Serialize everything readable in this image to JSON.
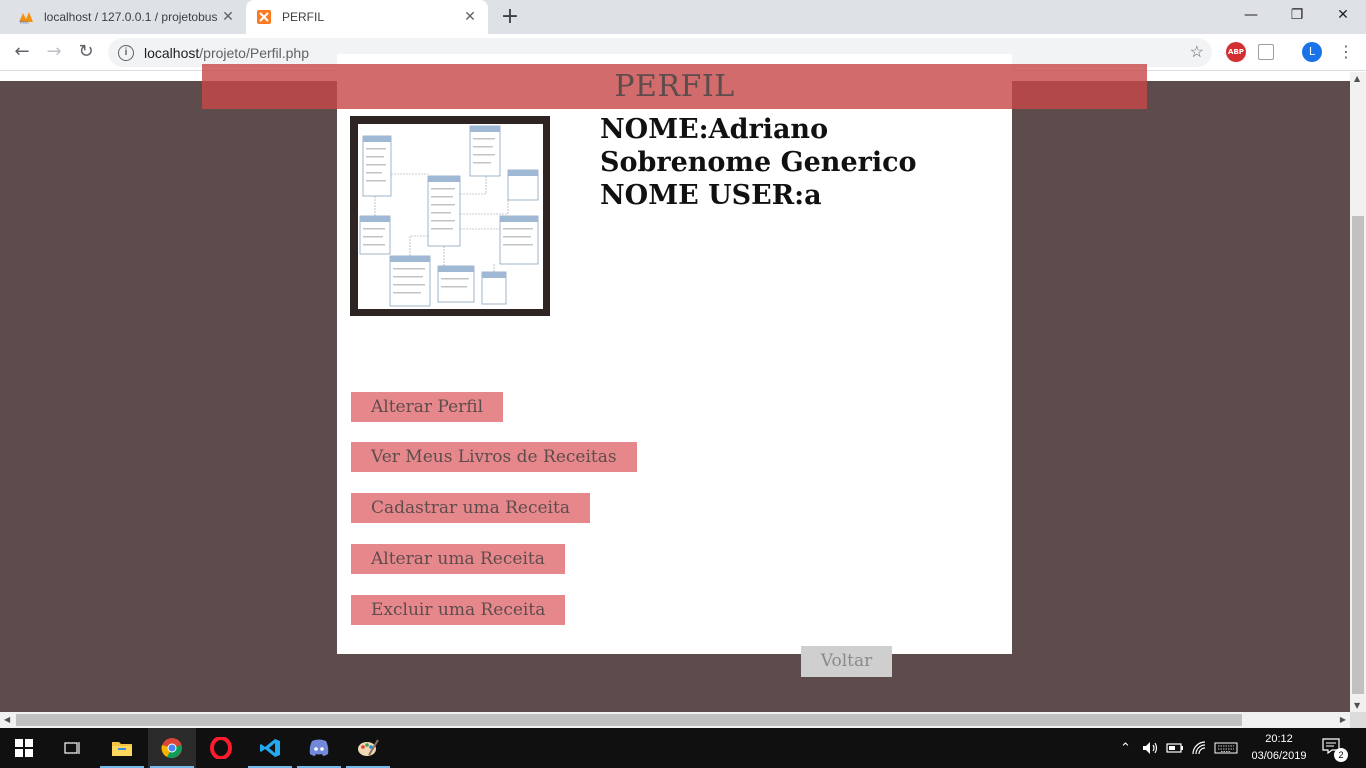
{
  "browser": {
    "tabs": [
      {
        "title": "localhost / 127.0.0.1 / projetobus",
        "active": false
      },
      {
        "title": "PERFIL",
        "active": true
      }
    ],
    "new_tab_symbol": "+",
    "url_host": "localhost",
    "url_path": "/projeto/Perfil.php",
    "extensions": {
      "adblock_label": "ABP",
      "profile_initial": "L"
    }
  },
  "page": {
    "banner_title": "PERFIL",
    "profile": {
      "name": "NOME:Adriano",
      "surname": "Sobrenome Generico",
      "username": "NOME USER:a"
    },
    "buttons": [
      {
        "label": "Alterar Perfil"
      },
      {
        "label": "Ver Meus Livros de Receitas"
      },
      {
        "label": "Cadastrar uma Receita"
      },
      {
        "label": "Alterar uma Receita"
      },
      {
        "label": "Excluir uma Receita"
      }
    ],
    "back_button": "Voltar",
    "colors": {
      "background": "#5e4c4d",
      "banner": "#c74747",
      "button": "#e6888b",
      "back_button": "#cfcfcf"
    }
  },
  "taskbar": {
    "time": "20:12",
    "date": "03/06/2019",
    "notification_count": "2"
  }
}
